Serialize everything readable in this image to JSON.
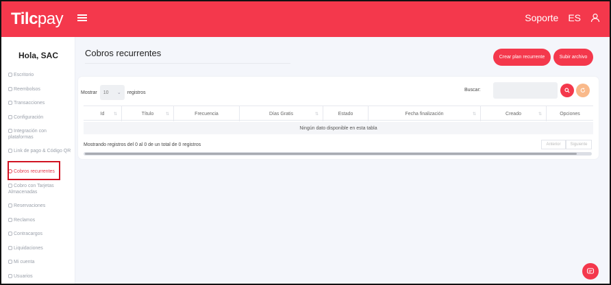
{
  "brand": {
    "logo_bold": "Tilc",
    "logo_light": "pay",
    "accent": "#f4384c"
  },
  "topbar": {
    "support": "Soporte",
    "language": "ES"
  },
  "sidebar": {
    "greeting": "Hola, SAC",
    "items": [
      {
        "label": "Escritorio"
      },
      {
        "label": "Reembolsos"
      },
      {
        "label": "Transacciones"
      },
      {
        "label": "Configuración"
      },
      {
        "label": "Integración con plataformas"
      },
      {
        "label": "Link de pago & Código QR"
      },
      {
        "label": "Cobros recurrentes"
      },
      {
        "label": "Cobro con Tarjetas Almacenadas"
      },
      {
        "label": "Reservaciones"
      },
      {
        "label": "Reclamos"
      },
      {
        "label": "Contracargos"
      },
      {
        "label": "Liquidaciones"
      },
      {
        "label": "Mi cuenta"
      },
      {
        "label": "Usuarios"
      }
    ]
  },
  "main": {
    "title": "Cobros recurrentes",
    "create_plan_button": "Crear plan recurrente",
    "upload_button": "Subir archivo",
    "show_label": "Mostrar",
    "page_size": "10",
    "records_label": "registros",
    "search_label": "Buscar:",
    "search_value": "",
    "columns": [
      "Id",
      "Título",
      "Frecuencia",
      "Días Gratis",
      "Estado",
      "Fecha finalización",
      "Creado",
      "Opciones"
    ],
    "empty_message": "Ningún dato disponible en esta tabla",
    "info": "Mostrando registros del 0 al 0 de un total de 0 registros",
    "prev": "Anterior",
    "next": "Siguiente"
  }
}
